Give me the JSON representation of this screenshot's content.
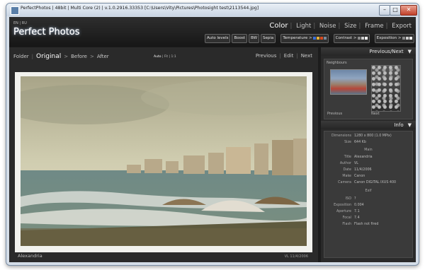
{
  "window": {
    "title": "PerfectPhotos | 48bit | Multi Core (2) | v.1.0.2916.33353 [C:\\Users\\Vity\\Pictures\\Photosight test\\2113544.jpg]",
    "minimize": "–",
    "maximize": "□",
    "close": "✕"
  },
  "header": {
    "lang": [
      "EN",
      "RU"
    ],
    "logo": "Perfect Photos",
    "nav": [
      "Color",
      "Light",
      "Noise",
      "Size",
      "Frame",
      "Export"
    ],
    "active_nav": "Color"
  },
  "tools": {
    "buttons": [
      "Auto levels",
      "Boost",
      "BW",
      "Sepia"
    ],
    "temperature": "Temperature >",
    "contrast": "Contrast >",
    "exposition": "Exposition >",
    "temp_swatches": [
      "#3b6fd6",
      "#e8b23a",
      "#d84a1e",
      "#7a8a9a"
    ],
    "contrast_swatches": [
      "#8a8a8a",
      "#cfcfcf",
      "#ffffff"
    ],
    "exposition_swatches": [
      "#8a8a8a",
      "#cfcfcf",
      "#ffffff"
    ]
  },
  "viewer": {
    "folder": "Folder",
    "original": "Original",
    "before": "Before",
    "after": "After",
    "zoom": [
      "Auto",
      "Fit",
      "1:1"
    ],
    "previous": "Previous",
    "edit": "Edit",
    "next": "Next",
    "caption": "Alexandria",
    "credit": "VL 11/4/2006"
  },
  "panel": {
    "prevnext_title": "Previous/Next",
    "neighbours": "Neighbours",
    "thumb_prev_label": "Previous",
    "thumb_next_label": "Next",
    "info_title": "Info",
    "info_rows": [
      {
        "k": "Dimensions",
        "v": "1280 x 800 (1.0 MPix)"
      },
      {
        "k": "Size",
        "v": "644 Kb"
      },
      {
        "section": "Main"
      },
      {
        "k": "Title",
        "v": "Alexandria"
      },
      {
        "k": "Author",
        "v": "VL"
      },
      {
        "k": "Date",
        "v": "11/4/2006"
      },
      {
        "k": "Make",
        "v": "Canon"
      },
      {
        "k": "Camera",
        "v": "Canon DIGITAL IXUS 400"
      },
      {
        "section": "Exif"
      },
      {
        "k": "ISO",
        "v": "?"
      },
      {
        "k": "Exposition",
        "v": "0.004"
      },
      {
        "k": "Aperture",
        "v": "7.1"
      },
      {
        "k": "Focal",
        "v": "7.4"
      },
      {
        "k": "Flash",
        "v": "Flash not fired"
      }
    ]
  },
  "icons": {
    "chevron": "▼",
    "gt": ">"
  }
}
